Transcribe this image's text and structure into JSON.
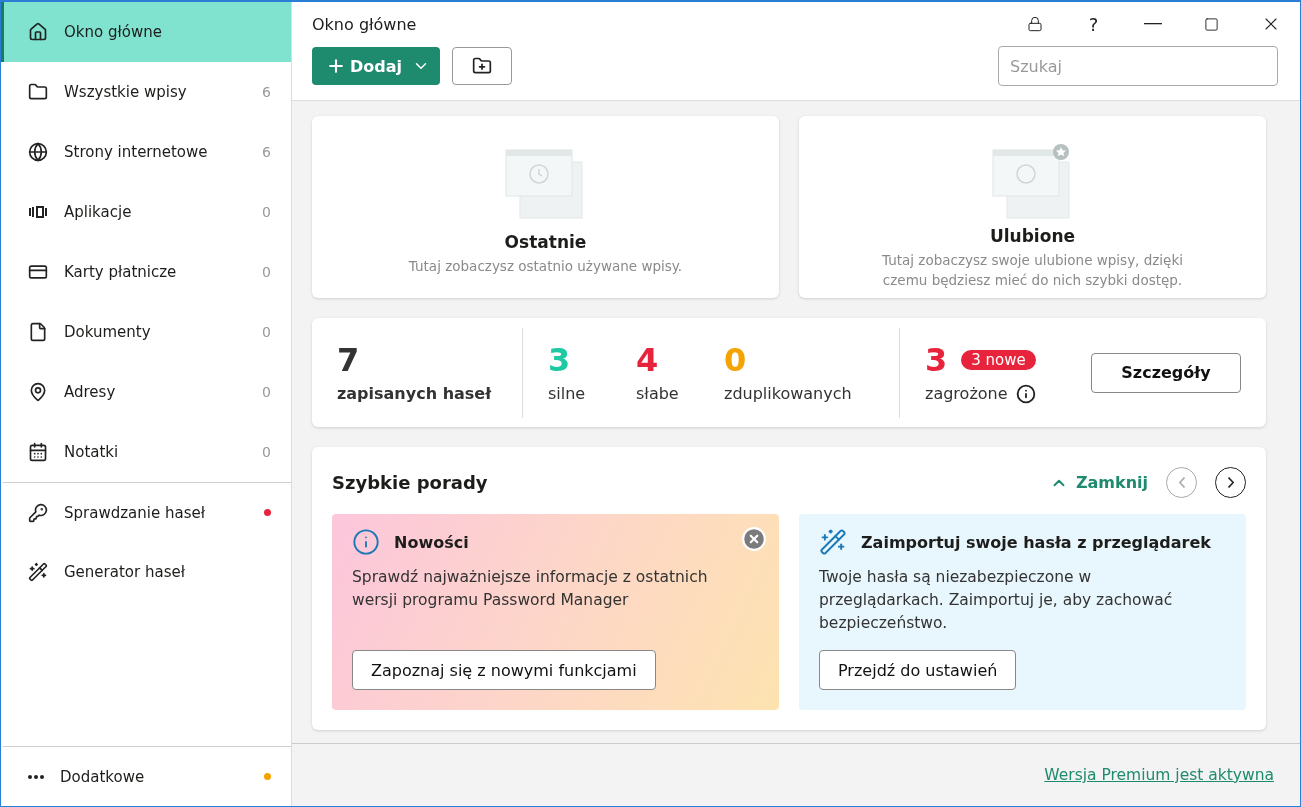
{
  "sidebar": {
    "items": [
      {
        "label": "Okno główne",
        "selected": true
      },
      {
        "label": "Wszystkie wpisy",
        "count": "6",
        "selected": false
      },
      {
        "label": "Strony internetowe",
        "count": "6",
        "selected": false
      },
      {
        "label": "Aplikacje",
        "count": "0",
        "selected": false
      },
      {
        "label": "Karty płatnicze",
        "count": "0",
        "selected": false
      },
      {
        "label": "Dokumenty",
        "count": "0",
        "selected": false
      },
      {
        "label": "Adresy",
        "count": "0",
        "selected": false
      },
      {
        "label": "Notatki",
        "count": "0",
        "selected": false
      }
    ],
    "tools": [
      {
        "label": "Sprawdzanie haseł",
        "color": "#e8243c",
        "selected": false
      },
      {
        "label": "Generator haseł",
        "selected": false
      }
    ],
    "bottom": {
      "label": "Dodatkowe",
      "color": "#f5a300"
    }
  },
  "window": {
    "title": "Okno główne",
    "help": "?"
  },
  "toolbar": {
    "add": "Dodaj",
    "search": {
      "placeholder": "Szukaj"
    }
  },
  "empty_cards": [
    {
      "kind": "recent",
      "title": "Ostatnie",
      "text": "Tutaj zobaczysz ostatnio używane wpisy."
    },
    {
      "kind": "favorites",
      "title": "Ulubione",
      "text": "Tutaj zobaczysz swoje ulubione wpisy, dzięki czemu będziesz mieć do nich szybki dostęp."
    }
  ],
  "stats": {
    "total": {
      "value": "7",
      "label": "zapisanych haseł"
    },
    "groups": [
      {
        "value": "3",
        "label": "silne",
        "color": "#1fc9a4"
      },
      {
        "value": "4",
        "label": "słabe",
        "color": "#e8243c"
      },
      {
        "value": "0",
        "label": "zduplikowanych",
        "color": "#f5a300"
      }
    ],
    "threats": {
      "value": "3",
      "badge": "3 nowe",
      "label": "zagrożone"
    },
    "button": "Szczegóły"
  },
  "tips": {
    "title": "Szybkie porady",
    "close": "Zamknij",
    "cards": [
      {
        "kind": "news",
        "title": "Nowości",
        "text": "Sprawdź najważniejsze informacje z ostatnich wersji programu  Password Manager",
        "button": "Zapoznaj się z nowymi funkcjami"
      },
      {
        "kind": "import",
        "title": "Zaimportuj swoje hasła z przeglądarek",
        "text": "Twoje hasła są niezabezpieczone w przeglądarkach. Zaimportuj je, aby zachować bezpieczeństwo.",
        "button": "Przejdź do ustawień"
      }
    ]
  },
  "footer": {
    "link": "Wersja Premium jest aktywna"
  }
}
